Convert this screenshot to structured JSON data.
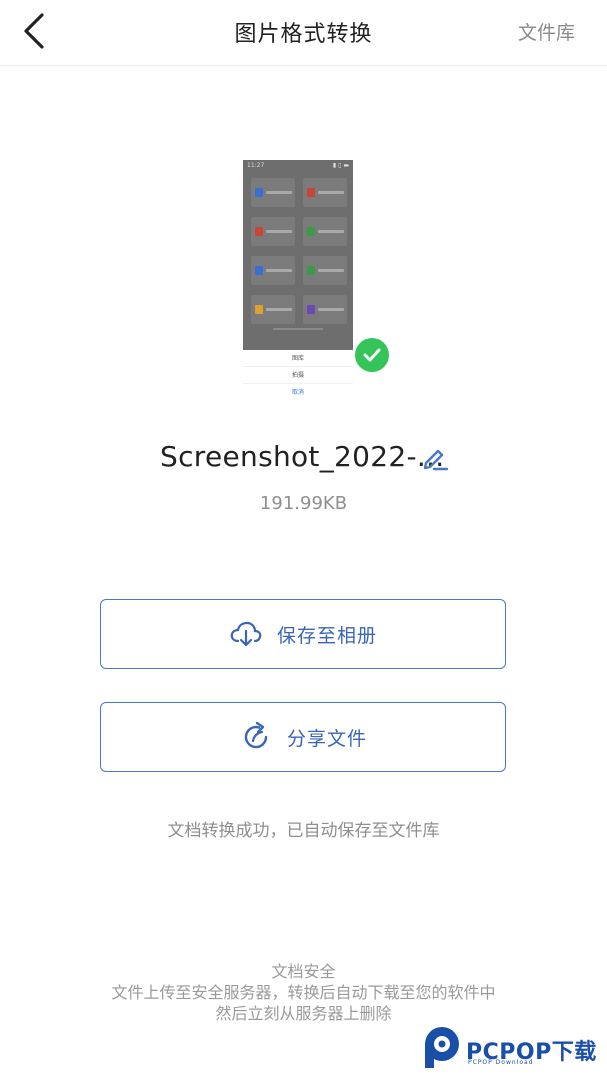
{
  "header": {
    "title": "图片格式转换",
    "right_link": "文件库"
  },
  "thumbnail": {
    "status_left": "11:27",
    "status_right": "▮ ▯ ▬",
    "tiles": [
      {
        "color": "#3a6ed0"
      },
      {
        "color": "#c8453a"
      },
      {
        "color": "#c8453a"
      },
      {
        "color": "#3a9a4a"
      },
      {
        "color": "#3a6ed0"
      },
      {
        "color": "#3a9a4a"
      },
      {
        "color": "#e0a030"
      },
      {
        "color": "#6a4ab0"
      }
    ],
    "menu": [
      "图库",
      "拍摄",
      "取消"
    ]
  },
  "file": {
    "name": "Screenshot_2022-...",
    "size": "191.99KB"
  },
  "actions": {
    "save_label": "保存至相册",
    "share_label": "分享文件"
  },
  "status": {
    "success": "文档转换成功，已自动保存至文件库"
  },
  "security": {
    "title": "文档安全",
    "line1": "文件上传至安全服务器，转换后自动下载至您的软件中",
    "line2": "然后立刻从服务器上删除"
  },
  "watermark": {
    "brand": "PCPOP下载",
    "sub": "PCPOP Download"
  },
  "colors": {
    "accent": "#3a66b8",
    "success": "#34c45a"
  }
}
